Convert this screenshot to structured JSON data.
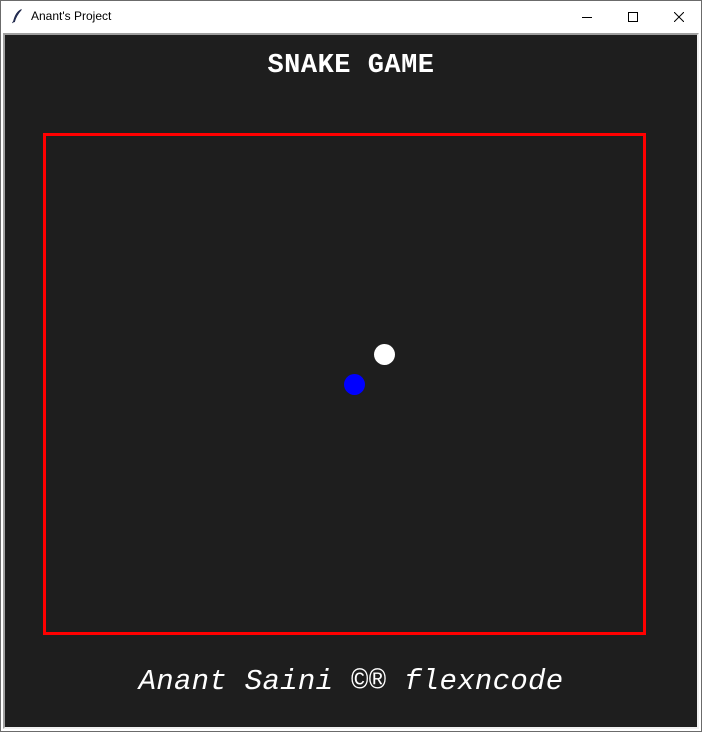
{
  "window": {
    "title": "Anant's Project",
    "icon": "feather-icon",
    "controls": {
      "minimize_icon": "minimize-icon",
      "maximize_icon": "maximize-icon",
      "close_icon": "close-icon"
    }
  },
  "game": {
    "title": "SNAKE GAME",
    "credits": "Anant Saini ©® flexncode",
    "colors": {
      "background": "#1e1e1e",
      "board_border": "#ff0000",
      "food": "#ffffff",
      "snake": "#0000ff",
      "text": "#ffffff"
    },
    "snake_length": 1
  }
}
